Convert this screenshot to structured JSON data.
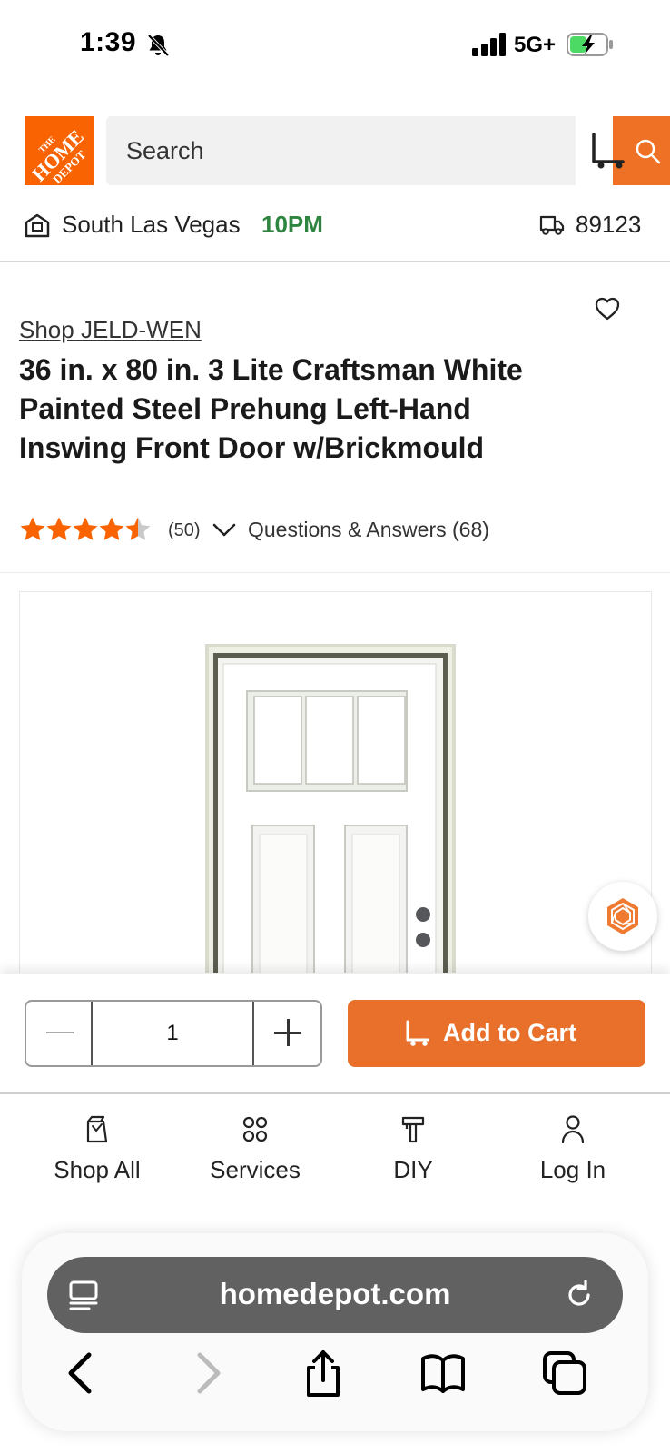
{
  "status_bar": {
    "time": "1:39",
    "network": "5G+"
  },
  "header": {
    "logo": {
      "line1": "THE",
      "line2": "HOME",
      "line3": "DEPOT"
    },
    "search_placeholder": "Search"
  },
  "store": {
    "name": "South Las Vegas",
    "hours": "10PM",
    "zip": "89123"
  },
  "product": {
    "brand_link": "Shop JELD-WEN",
    "title": "36 in. x 80 in. 3 Lite Craftsman White Painted Steel Prehung Left-Hand Inswing Front Door w/Brickmould",
    "rating": 4.5,
    "review_count": "(50)",
    "qa_link": "Questions & Answers (68)"
  },
  "cart_bar": {
    "quantity": "1",
    "add_to_cart_label": "Add to Cart"
  },
  "bottom_nav": {
    "items": [
      {
        "label": "Shop All",
        "icon": "shopping-bag-icon"
      },
      {
        "label": "Services",
        "icon": "grid-dots-icon"
      },
      {
        "label": "DIY",
        "icon": "hammer-icon"
      },
      {
        "label": "Log In",
        "icon": "user-icon"
      }
    ]
  },
  "browser": {
    "url": "homedepot.com"
  },
  "colors": {
    "brand_orange": "#f96302",
    "button_orange": "#e8702a",
    "store_hours_green": "#2e8540",
    "star_orange": "#f96302"
  }
}
